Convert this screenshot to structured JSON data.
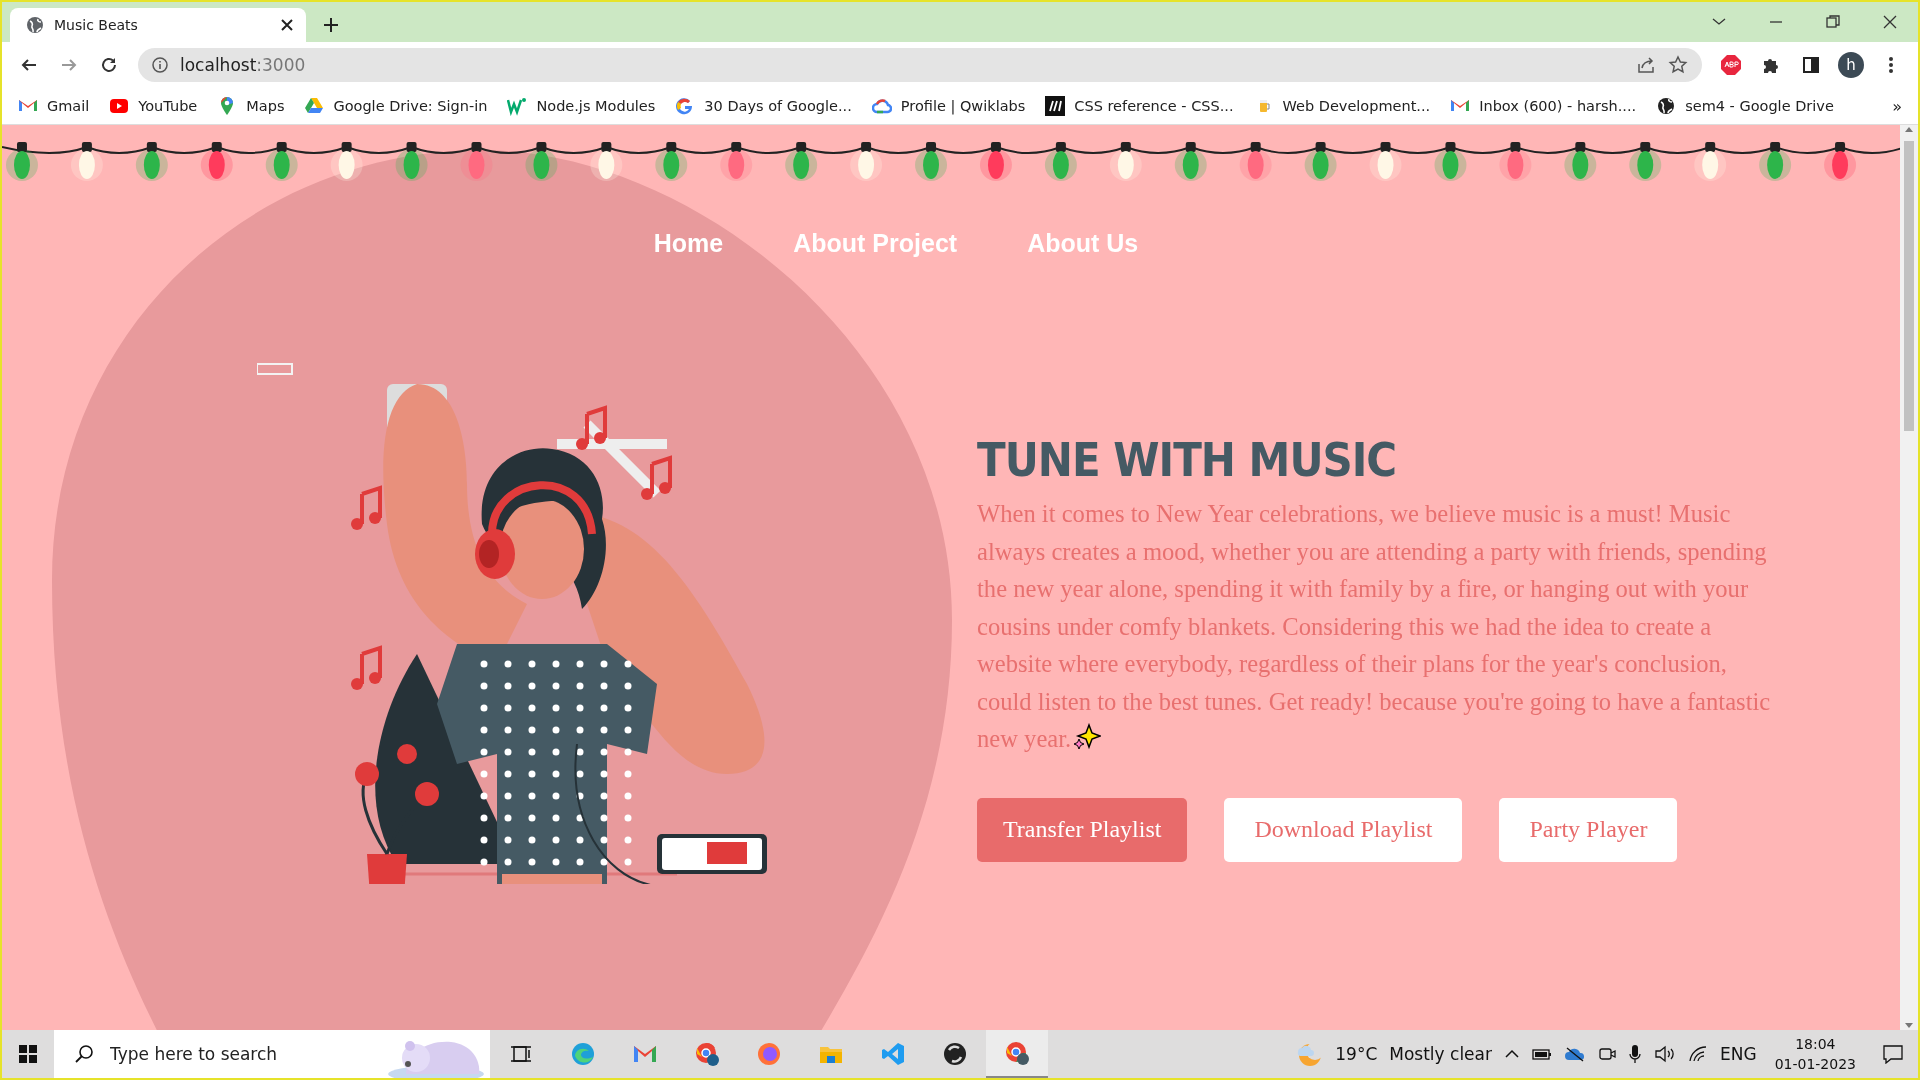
{
  "browser": {
    "tabs": [
      {
        "title": "Music Beats",
        "selected": true
      }
    ],
    "address": {
      "host": "localhost",
      "port": ":3000"
    },
    "bookmarks": [
      {
        "label": "Gmail",
        "kind": "gmail"
      },
      {
        "label": "YouTube",
        "kind": "youtube"
      },
      {
        "label": "Maps",
        "kind": "maps"
      },
      {
        "label": "Google Drive: Sign-in",
        "kind": "drive"
      },
      {
        "label": "Node.js Modules",
        "kind": "w3"
      },
      {
        "label": "30 Days of Google...",
        "kind": "google"
      },
      {
        "label": "Profile | Qwiklabs",
        "kind": "cloud"
      },
      {
        "label": "CSS reference - CSS...",
        "kind": "mdn"
      },
      {
        "label": "Web Development...",
        "kind": "beer"
      },
      {
        "label": "Inbox (600) - harsh....",
        "kind": "gmail"
      },
      {
        "label": "sem4 - Google Drive",
        "kind": "globe"
      }
    ],
    "bookmarks_overflow": "»",
    "profile_initial": "h"
  },
  "page": {
    "nav": [
      {
        "label": "Home"
      },
      {
        "label": "About Project"
      },
      {
        "label": "About Us"
      }
    ],
    "heading": "TUNE WITH MUSIC",
    "paragraph": "When it comes to New Year celebrations, we believe music is a must! Music always creates a mood, whether you are attending a party with friends, spending the new year alone, spending it with family by a fire, or hanging out with your cousins under comfy blankets. Considering this we had the idea to create a website where everybody, regardless of their plans for the year's conclusion, could listen to the best tunes. Get ready! because you're going to have a fantastic new year.",
    "buttons": [
      {
        "label": "Transfer Playlist",
        "kind": "filled"
      },
      {
        "label": "Download Playlist",
        "kind": "outline"
      },
      {
        "label": "Party Player",
        "kind": "outline"
      }
    ]
  },
  "taskbar": {
    "search": {
      "placeholder": "Type here to search"
    },
    "weather": {
      "temperature": "19°C",
      "condition": "Mostly clear"
    },
    "language": "ENG",
    "time": "18:04",
    "date": "01-01-2023"
  }
}
